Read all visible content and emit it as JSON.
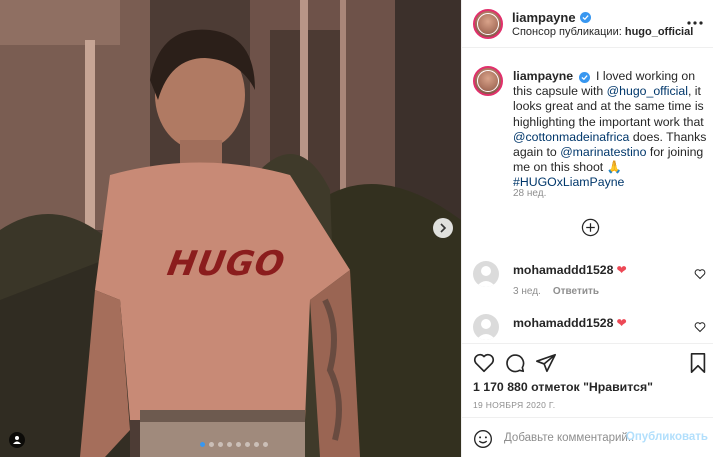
{
  "post": {
    "username": "liampayne",
    "sponsor_label": "Спонсор публикации:",
    "sponsor_name": "hugo_official"
  },
  "caption": {
    "username": "liampayne",
    "text_1": "I loved working on this capsule with",
    "mention_1": "@hugo_official",
    "text_2": ", it looks great and at the same time is highlighting the important work that",
    "mention_2": "@cottonmadeinafrica",
    "text_3": "does. Thanks again to",
    "mention_3": "@marinatestino",
    "text_4": "for joining me on this shoot 🙏",
    "hashtag": "#HUGOxLiamPayne",
    "time": "28 нед."
  },
  "comments": [
    {
      "username": "mohamaddd1528",
      "emoji": "❤",
      "time": "3 нед.",
      "reply_label": "Ответить"
    },
    {
      "username": "mohamaddd1528",
      "emoji": "❤"
    }
  ],
  "likes_text": "1 170 880 отметок \"Нравится\"",
  "date_text": "19 НОЯБРЯ 2020 Г.",
  "comment_form": {
    "placeholder": "Добавьте комментарий...",
    "post_label": "Опубликовать"
  },
  "shirt_text": "HUGO",
  "carousel": {
    "slide_count": 8,
    "active_index": 0
  },
  "colors": {
    "verified": "#3897f0",
    "link": "#00376b",
    "heart": "#ed4956",
    "post_disabled": "#b2dffc"
  },
  "icons": [
    "next-slide-icon",
    "user-tag-icon",
    "more-options-icon",
    "verified-badge-icon",
    "load-more-comments-icon",
    "heart-icon",
    "comment-icon",
    "share-icon",
    "save-icon",
    "emoji-icon"
  ]
}
